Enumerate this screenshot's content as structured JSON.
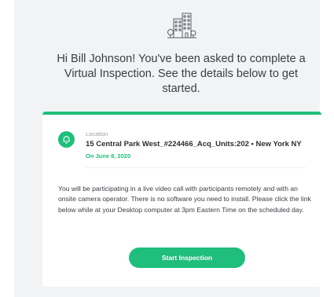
{
  "header": {
    "logo_icon": "city-building-icon",
    "greeting": "Hi Bill Johnson! You've been asked to complete a Virtual Inspection. See the details below to get started."
  },
  "card": {
    "accent_color": "#1fbe7c",
    "location_icon": "bell-icon",
    "location_label": "Location",
    "address": "15 Central Park West_#224466_Acq_Units:202 • New York NY",
    "date": "On June 8, 2020",
    "description": "You will be participating in a live video call with participants remotely and with an onsite camera operator. There is no software you need to install. Please click the link below while at your Desktop computer at 3pm Eastern Time on the scheduled day.",
    "button_label": "Start Inspection"
  }
}
